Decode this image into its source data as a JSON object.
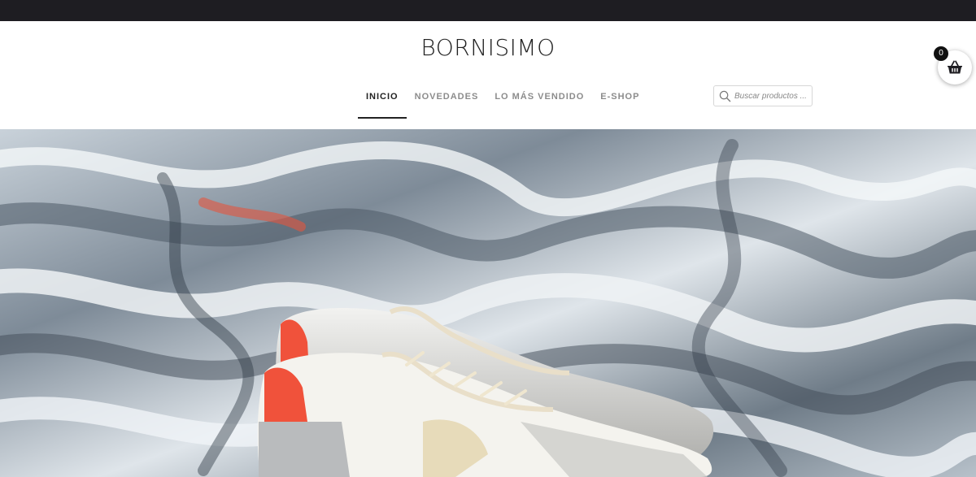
{
  "site": {
    "title": "BORNISIMO"
  },
  "nav": {
    "items": [
      {
        "label": "INICIO",
        "active": true
      },
      {
        "label": "NOVEDADES",
        "active": false
      },
      {
        "label": "LO MÁS VENDIDO",
        "active": false
      },
      {
        "label": "E-SHOP",
        "active": false
      }
    ]
  },
  "search": {
    "placeholder": "Buscar productos ...",
    "icon": "search-icon"
  },
  "cart": {
    "count": "0",
    "icon": "basket-icon"
  },
  "hero": {
    "description_icon": "sneakers-image",
    "accent_color": "#f0523b"
  },
  "colors": {
    "topbar": "#1e1d22",
    "text": "#222222",
    "muted": "#8c8c8c"
  }
}
